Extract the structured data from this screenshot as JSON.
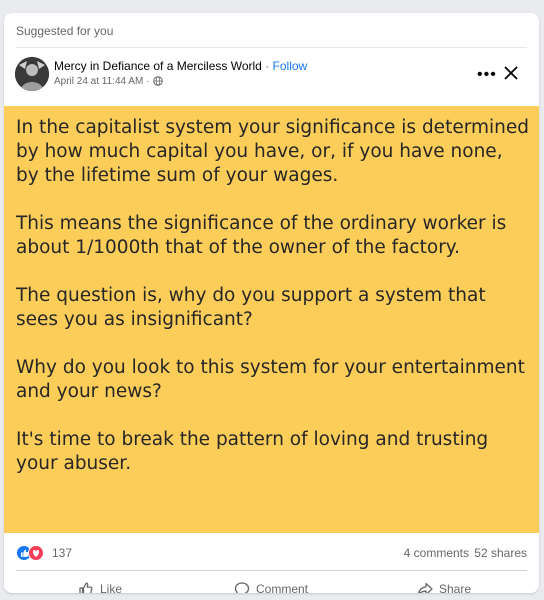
{
  "header": {
    "suggested_label": "Suggested for you"
  },
  "post": {
    "page_name": "Mercy in Defiance of a Merciless World",
    "separator": "·",
    "follow_label": "Follow",
    "timestamp": "April 24 at 11:44 AM ·",
    "paragraphs": [
      "In the capitalist system your significance is determined by how much capital you have, or, if you have none, by the lifetime sum of your wages.",
      "This means the significance of the ordinary worker is about 1/1000th that of the owner of the factory.",
      "The question is, why do you support a system that sees you as insignificant?",
      "Why do you look to this system for your entertainment and your news?",
      "It's time to break the pattern of loving and trusting your abuser."
    ]
  },
  "stats": {
    "reaction_count": "137",
    "comments": "4 comments",
    "shares": "52 shares"
  },
  "actions": {
    "like": "Like",
    "comment": "Comment",
    "share": "Share"
  },
  "colors": {
    "image_background": "#fdcd59",
    "follow_link": "#1877f2",
    "like_reaction": "#1877f2",
    "love_reaction": "#f33e58"
  }
}
